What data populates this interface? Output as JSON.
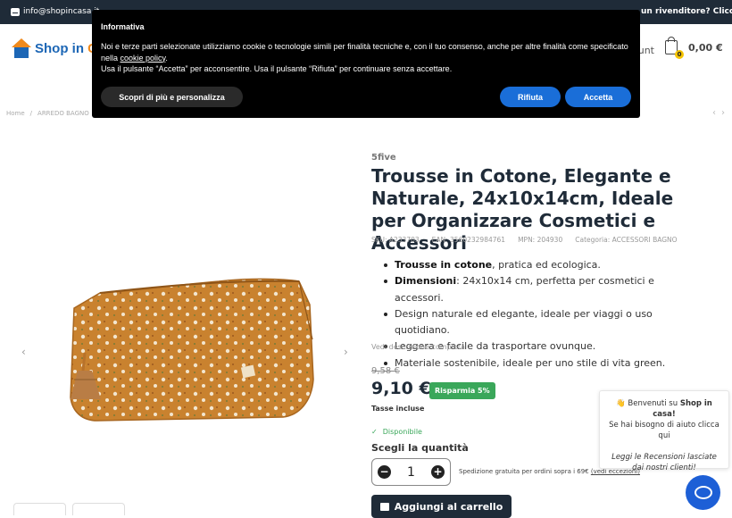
{
  "topbar": {
    "email": "info@shopincasa.it",
    "right_text": "un rivenditore? Clicca qui"
  },
  "header": {
    "logo_word_main": "Shop in ",
    "logo_word_accent": "C",
    "account_label": "ount",
    "cart_count": "0",
    "cart_amount": "0,00 €"
  },
  "breadcrumb": [
    "Home",
    "/",
    "ARREDO BAGNO"
  ],
  "cookie": {
    "title": "Informativa",
    "line1": "Noi e terze parti selezionate utilizziamo cookie o tecnologie simili per finalità tecniche e, con il tuo consenso, anche per altre finalità come specificato nella ",
    "policy_link": "cookie policy",
    "line1_end": ".",
    "line2": "Usa il pulsante “Accetta” per acconsentire. Usa il pulsante “Rifiuta” per continuare senza accettare.",
    "more_label": "Scopri di più e personalizza",
    "reject_label": "Rifiuta",
    "accept_label": "Accetta"
  },
  "product": {
    "brand": "5five",
    "title": "Trousse in Cotone, Elegante e Naturale, 24x10x14cm, Ideale per Organizzare Cosmetici e Accessori",
    "sku": "SKU: A233703",
    "ean": "EAN: 3560232984761",
    "mpn": "MPN: 204930",
    "category": "Categoria: ACCESSORI BAGNO",
    "bullets": [
      {
        "bold": "Trousse in cotone",
        "text": ", pratica ed ecologica."
      },
      {
        "bold": "Dimensioni",
        "text": ": 24x10x14 cm, perfetta per cosmetici e accessori."
      },
      {
        "bold": "",
        "text": "Design naturale ed elegante, ideale per viaggi o uso quotidiano."
      },
      {
        "bold": "",
        "text": "Leggera e facile da trasportare ovunque."
      },
      {
        "bold": "",
        "text": "Materiale sostenibile, ideale per uno stile di vita green."
      }
    ],
    "desc_link": "Vedi descrizione completa",
    "old_price": "9,58 €",
    "price": "9,10 €",
    "save_badge": "Risparmia 5%",
    "tax": "Tasse incluse",
    "availability": "Disponibile",
    "qty_label": "Scegli la quantità",
    "qty_value": "1",
    "ship_note": "Spedizione gratuita per ordini sopra i 69€ ",
    "ship_link": "(vedi eccezioni)",
    "add_to_cart": "Aggiungi al carrello"
  },
  "chat": {
    "line1_pre": "👋 Benvenuti su ",
    "line1_bold": "Shop in casa!",
    "line2": "Se hai bisogno di aiuto clicca qui",
    "line3": "Leggi le Recensioni lasciate dai nostri clienti!"
  },
  "colors": {
    "topbar": "#1f2b38",
    "brand_blue": "#1c66b5",
    "brand_orange": "#f08a1c",
    "accept_blue": "#1a6ed8",
    "save_green": "#3aa75a"
  }
}
